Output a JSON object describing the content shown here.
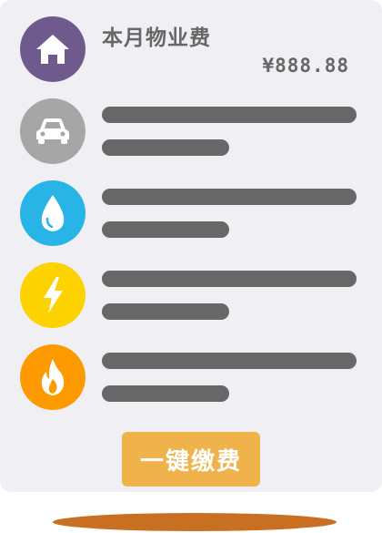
{
  "header": {
    "title": "本月物业费",
    "amount": "¥888.88"
  },
  "rows": [
    {
      "icon": "house-icon",
      "color": "#6e5a8c"
    },
    {
      "icon": "car-icon",
      "color": "#a6a6a6"
    },
    {
      "icon": "water-drop-icon",
      "color": "#28b4e6"
    },
    {
      "icon": "lightning-icon",
      "color": "#fcd200"
    },
    {
      "icon": "flame-icon",
      "color": "#fc9a00"
    }
  ],
  "actions": {
    "pay_label": "一键缴费"
  },
  "colors": {
    "card_bg": "#efeff4",
    "bar": "#676767",
    "button": "#f0b34c",
    "shadow": "#c86f22"
  }
}
